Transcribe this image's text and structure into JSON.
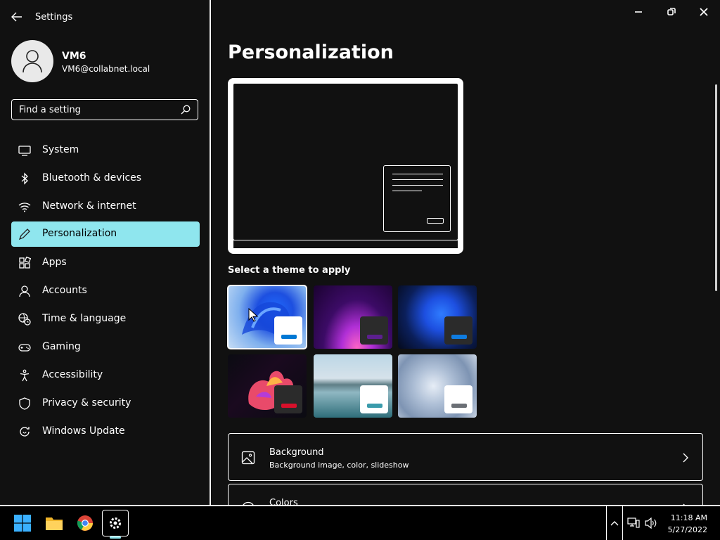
{
  "app": {
    "title": "Settings"
  },
  "user": {
    "name": "VM6",
    "email": "VM6@collabnet.local"
  },
  "search": {
    "placeholder": "Find a setting",
    "value": ""
  },
  "sidebar": {
    "items": [
      {
        "label": "System",
        "icon": "monitor-icon",
        "active": false
      },
      {
        "label": "Bluetooth & devices",
        "icon": "bluetooth-icon",
        "active": false
      },
      {
        "label": "Network & internet",
        "icon": "wifi-icon",
        "active": false
      },
      {
        "label": "Personalization",
        "icon": "pen-icon",
        "active": true
      },
      {
        "label": "Apps",
        "icon": "apps-icon",
        "active": false
      },
      {
        "label": "Accounts",
        "icon": "person-icon",
        "active": false
      },
      {
        "label": "Time & language",
        "icon": "globe-clock-icon",
        "active": false
      },
      {
        "label": "Gaming",
        "icon": "gamepad-icon",
        "active": false
      },
      {
        "label": "Accessibility",
        "icon": "accessibility-icon",
        "active": false
      },
      {
        "label": "Privacy & security",
        "icon": "shield-icon",
        "active": false
      },
      {
        "label": "Windows Update",
        "icon": "update-icon",
        "active": false
      }
    ]
  },
  "main": {
    "title": "Personalization",
    "themes_label": "Select a theme to apply",
    "themes": [
      {
        "name": "windows-light",
        "accent": "#0078d4",
        "selected": true
      },
      {
        "name": "windows-glow",
        "accent": "#5c1f8f",
        "selected": false
      },
      {
        "name": "windows-dark",
        "accent": "#0f7ce0",
        "selected": false
      },
      {
        "name": "captured-motion",
        "accent": "#d8102b",
        "selected": false
      },
      {
        "name": "sunrise",
        "accent": "#3a9bab",
        "selected": false
      },
      {
        "name": "flow",
        "accent": "#6b6f75",
        "selected": false
      }
    ],
    "cards": [
      {
        "title": "Background",
        "subtitle": "Background image, color, slideshow",
        "icon": "image-icon"
      },
      {
        "title": "Colors",
        "subtitle": "",
        "icon": "palette-icon"
      }
    ]
  },
  "taskbar": {
    "apps": [
      "start-icon",
      "file-explorer-icon",
      "chrome-icon",
      "settings-icon"
    ],
    "time": "11:18 AM",
    "date": "5/27/2022"
  },
  "colors": {
    "accent": "#8fe6ee",
    "background": "#111111"
  }
}
